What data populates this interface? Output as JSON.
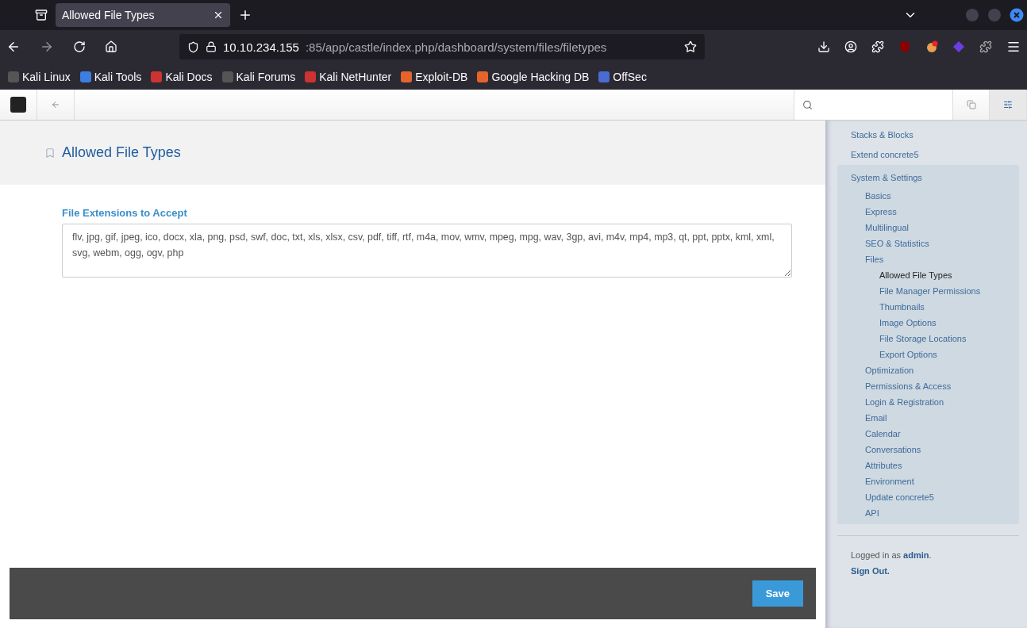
{
  "browser": {
    "tabs": [
      {
        "title": "Allowed File Types",
        "selected": true
      }
    ],
    "url_host": "10.10.234.155",
    "url_path": ":85/app/castle/index.php/dashboard/system/files/filetypes",
    "bookmarks": [
      "Kali Linux",
      "Kali Tools",
      "Kali Docs",
      "Kali Forums",
      "Kali NetHunter",
      "Exploit-DB",
      "Google Hacking DB",
      "OffSec"
    ]
  },
  "page": {
    "title": "Allowed File Types",
    "field_label": "File Extensions to Accept",
    "field_value": "flv, jpg, gif, jpeg, ico, docx, xla, png, psd, swf, doc, txt, xls, xlsx, csv, pdf, tiff, rtf, m4a, mov, wmv, mpeg, mpg, wav, 3gp, avi, m4v, mp4, mp3, qt, ppt, pptx, kml, xml, svg, webm, ogg, ogv, php",
    "save_button": "Save"
  },
  "sidebar": {
    "items": [
      {
        "label": "Stacks & Blocks",
        "selected": false
      },
      {
        "label": "Extend concrete5",
        "selected": false
      },
      {
        "label": "System & Settings",
        "selected": false,
        "expanded": true,
        "children": [
          {
            "label": "Basics",
            "selected": false
          },
          {
            "label": "Express",
            "selected": false
          },
          {
            "label": "Multilingual",
            "selected": false
          },
          {
            "label": "SEO & Statistics",
            "selected": false
          },
          {
            "label": "Files",
            "selected": false,
            "expanded": true,
            "children": [
              {
                "label": "Allowed File Types",
                "selected": true
              },
              {
                "label": "File Manager Permissions",
                "selected": false
              },
              {
                "label": "Thumbnails",
                "selected": false
              },
              {
                "label": "Image Options",
                "selected": false
              },
              {
                "label": "File Storage Locations",
                "selected": false
              },
              {
                "label": "Export Options",
                "selected": false
              }
            ]
          },
          {
            "label": "Optimization",
            "selected": false
          },
          {
            "label": "Permissions & Access",
            "selected": false
          },
          {
            "label": "Login & Registration",
            "selected": false
          },
          {
            "label": "Email",
            "selected": false
          },
          {
            "label": "Calendar",
            "selected": false
          },
          {
            "label": "Conversations",
            "selected": false
          },
          {
            "label": "Attributes",
            "selected": false
          },
          {
            "label": "Environment",
            "selected": false
          },
          {
            "label": "Update concrete5",
            "selected": false
          },
          {
            "label": "API",
            "selected": false
          }
        ]
      }
    ],
    "login_text": "Logged in as **admin**.",
    "sign_out": "Sign Out."
  }
}
